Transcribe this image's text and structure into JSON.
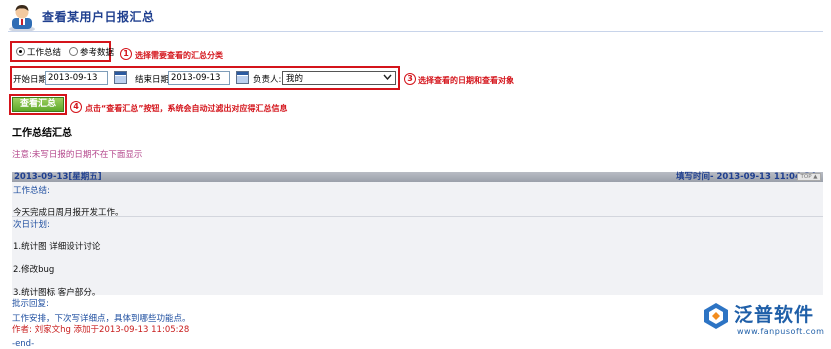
{
  "header": {
    "title": "查看某用户日报汇总"
  },
  "category": {
    "options": [
      {
        "label": "工作总结",
        "selected": true
      },
      {
        "label": "参考数据",
        "selected": false
      }
    ],
    "callout_num": "1",
    "callout_text": "选择需要查看的汇总分类"
  },
  "filters": {
    "start_label": "开始日期:",
    "start_value": "2013-09-13",
    "end_label": "结束日期:",
    "end_value": "2013-09-13",
    "owner_label": "负责人:",
    "owner_value": "我的",
    "callout_num": "3",
    "callout_text": "选择查看的日期和查看对象"
  },
  "view_button": {
    "label": "查看汇总",
    "callout_num": "4",
    "callout_text": "点击“查看汇总”按钮，系统会自动过滤出对应得汇总信息"
  },
  "section": {
    "title": "工作总结汇总",
    "note": "注意:未写日报的日期不在下面显示"
  },
  "record": {
    "date": "2013-09-13[星期五]",
    "fill_time": "填写时间- 2013-09-13 11:04:34",
    "top_label": "TOP ▲",
    "summary_label": "工作总结:",
    "summary_text": "今天完成日周月报开发工作。",
    "plan_label": "次日计划:",
    "plan_items": [
      "1.统计图 详细设计讨论",
      "2.修改bug",
      "3.统计图标 客户部分。"
    ],
    "reply_label": "批示回复:",
    "reply_text": "工作安排，下次写详细点，具体到哪些功能点。",
    "author_text": "作者: 刘家文hg  添加于2013-09-13 11:05:28",
    "end_text": "-end-"
  },
  "logo": {
    "name": "泛普软件",
    "url": "www.fanpusoft.com"
  },
  "colors": {
    "accent_red": "#d4141b",
    "link_blue": "#1f4fa0",
    "button_green": "#5ea82a",
    "note_pink": "#b4478c"
  }
}
